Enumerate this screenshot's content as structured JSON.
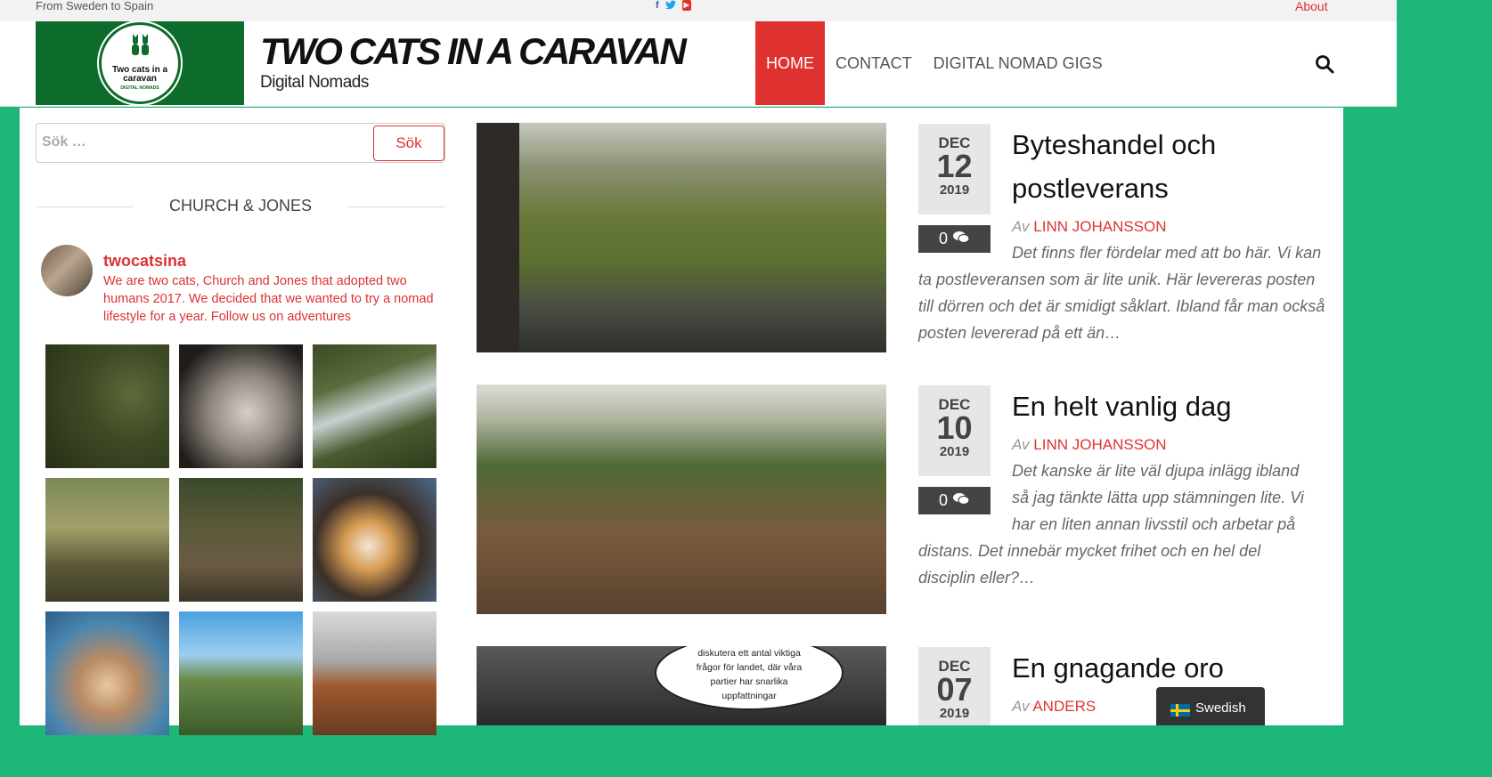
{
  "topbar": {
    "tagline": "From Sweden to Spain",
    "social": [
      "facebook-icon",
      "twitter-icon",
      "youtube-icon"
    ],
    "about": "About"
  },
  "header": {
    "logo_text": "Two cats in a caravan",
    "logo_sub": "DIGITAL NOMADS",
    "title": "TWO CATS IN A CARAVAN",
    "subtitle": "Digital Nomads",
    "nav": [
      {
        "label": "HOME",
        "active": true
      },
      {
        "label": "CONTACT",
        "active": false
      },
      {
        "label": "DIGITAL NOMAD GIGS",
        "active": false
      }
    ]
  },
  "sidebar": {
    "search": {
      "placeholder": "Sök …",
      "button": "Sök"
    },
    "widget_title": "CHURCH & JONES",
    "instagram": {
      "username": "twocatsina",
      "bio": "We are two cats, Church and Jones that adopted two humans 2017. We decided that we wanted to try a nomad lifestyle for a year. Follow us on adventures"
    }
  },
  "posts": [
    {
      "month": "DEC",
      "day": "12",
      "year": "2019",
      "comments": "0",
      "title_lines": [
        "Byteshandel och",
        "postleverans"
      ],
      "by": "Av",
      "author": "LINN JOHANSSON",
      "excerpt": "Det finns fler fördelar med att bo här. Vi kan ta postleveransen som är lite unik. Här levereras posten till dörren och det är smidigt såklart. Ibland får man också posten levererad på ett än…"
    },
    {
      "month": "DEC",
      "day": "10",
      "year": "2019",
      "comments": "0",
      "title_lines": [
        "En helt vanlig dag"
      ],
      "by": "Av",
      "author": "LINN JOHANSSON",
      "excerpt_lines": [
        "Det kanske är lite väl djupa inlägg ibland",
        "så jag tänkte lätta upp stämningen lite. Vi",
        "har en liten annan livsstil och arbetar på",
        "distans. Det innebär mycket frihet och en hel del",
        "disciplin eller?…"
      ]
    },
    {
      "month": "DEC",
      "day": "07",
      "year": "2019",
      "title_lines": [
        "En gnagande oro"
      ],
      "by": "Av",
      "author": "ANDERS",
      "image_caption": [
        "diskutera ett antal viktiga",
        "frågor för landet, där våra",
        "partier har snarlika",
        "uppfattningar"
      ]
    }
  ],
  "language": {
    "label": "Swedish"
  },
  "colors": {
    "accent": "#e03131",
    "background": "#1db77a",
    "logo_bg": "#0d6b2b"
  }
}
